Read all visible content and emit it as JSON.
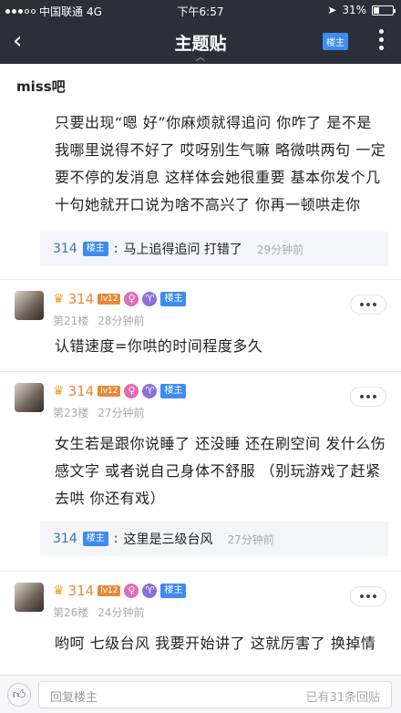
{
  "status_bar": {
    "carrier": "中国联通",
    "network": "4G",
    "time": "下午6:57",
    "battery": "31%",
    "battery_level": 0.31
  },
  "nav": {
    "title": "主题贴",
    "lz_badge": "楼主"
  },
  "forum_name": "miss吧",
  "main_post": {
    "text": "只要出现“嗯 好”你麻烦就得追问 你咋了 是不是我哪里说得不好了 哎呀别生气嘛 略微哄两句 一定要不停的发消息 这样体会她很重要 基本你发个几十句她就开口说为啥不高兴了 你再一顿哄走你",
    "quote": {
      "user": "314",
      "badge": "楼主",
      "text": "马上追得追问 打错了",
      "time": "29分钟前"
    }
  },
  "replies": [
    {
      "name": "314",
      "level": "lv12",
      "floor": "第21楼",
      "time": "28分钟前",
      "badge": "楼主",
      "text": "认错速度=你哄的时间程度多久"
    },
    {
      "name": "314",
      "level": "lv12",
      "floor": "第23楼",
      "time": "27分钟前",
      "badge": "楼主",
      "text": "女生若是跟你说睡了 还没睡 还在刷空间 发什么伤感文字 或者说自己身体不舒服 （别玩游戏了赶紧去哄 你还有戏）",
      "quote": {
        "user": "314",
        "badge": "楼主",
        "text": "这里是三级台风",
        "time": "27分钟前"
      }
    },
    {
      "name": "314",
      "level": "lv12",
      "floor": "第26楼",
      "time": "24分钟前",
      "badge": "楼主",
      "text": "哟呵 七级台风 我要开始讲了 这就厉害了 换掉情"
    }
  ],
  "bottom_bar": {
    "placeholder": "回复楼主",
    "reply_count": "已有31条回贴"
  }
}
